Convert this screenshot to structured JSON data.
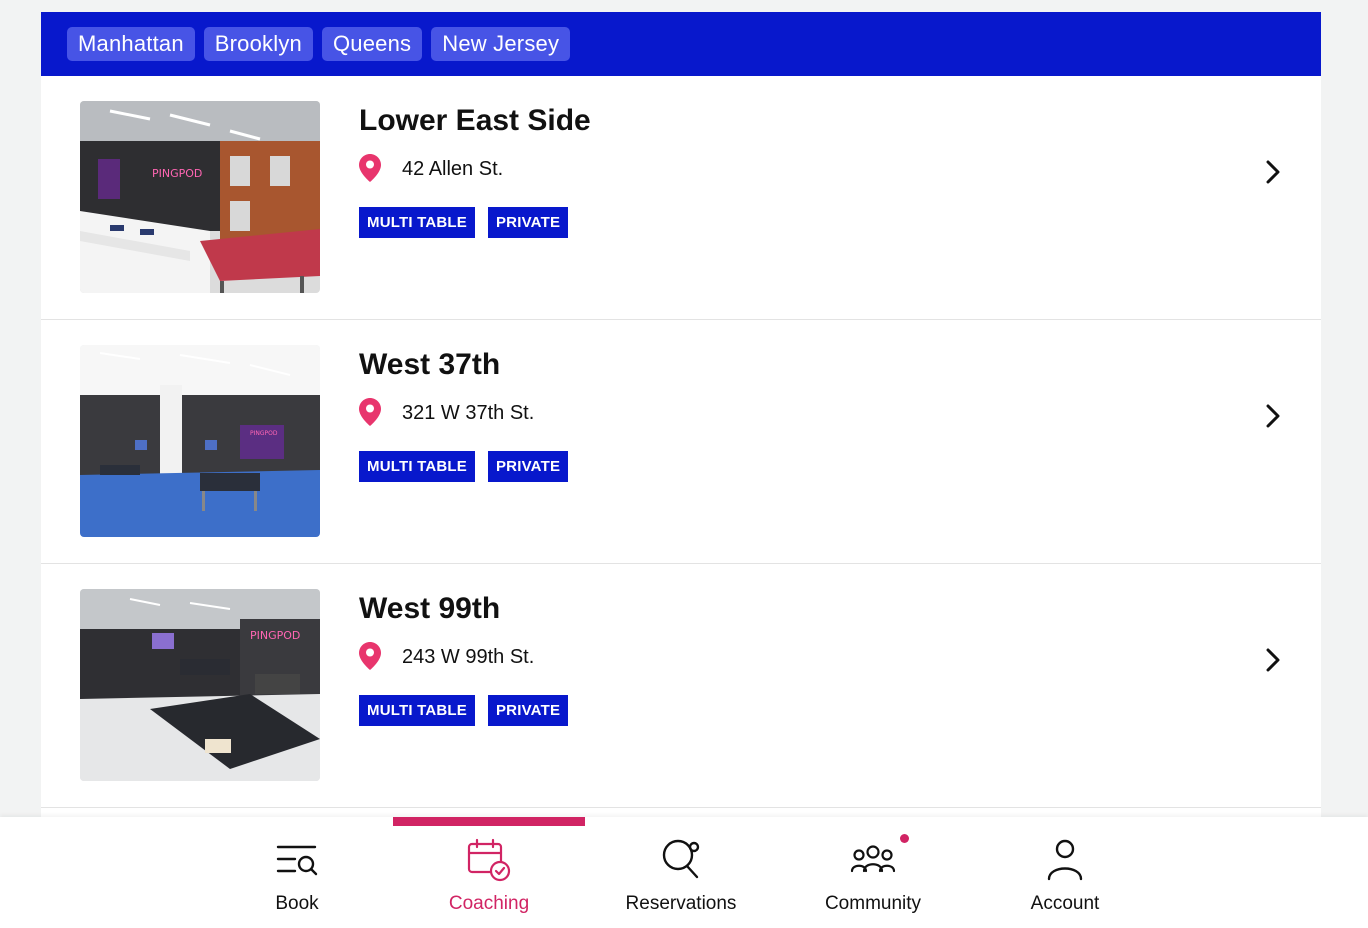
{
  "filters": [
    "Manhattan",
    "Brooklyn",
    "Queens",
    "New Jersey"
  ],
  "locations": [
    {
      "name": "Lower East Side",
      "address": "42 Allen St.",
      "tags": [
        "MULTI TABLE",
        "PRIVATE"
      ]
    },
    {
      "name": "West 37th",
      "address": "321 W 37th St.",
      "tags": [
        "MULTI TABLE",
        "PRIVATE"
      ]
    },
    {
      "name": "West 99th",
      "address": "243 W 99th St.",
      "tags": [
        "MULTI TABLE",
        "PRIVATE"
      ]
    }
  ],
  "tabs": {
    "book": "Book",
    "coaching": "Coaching",
    "reservations": "Reservations",
    "community": "Community",
    "account": "Account"
  },
  "active_tab": "coaching",
  "icons": {
    "location": "map-pin-icon",
    "row_action": "chevron-right-icon",
    "book": "search-list-icon",
    "coaching": "calendar-check-icon",
    "reservations": "ping-pong-paddle-icon",
    "community": "people-group-icon",
    "account": "person-icon"
  },
  "colors": {
    "brand_blue": "#0818cc",
    "chip_blue": "#4754e6",
    "accent_pink": "#d12464",
    "pin_pink": "#e8356d"
  }
}
